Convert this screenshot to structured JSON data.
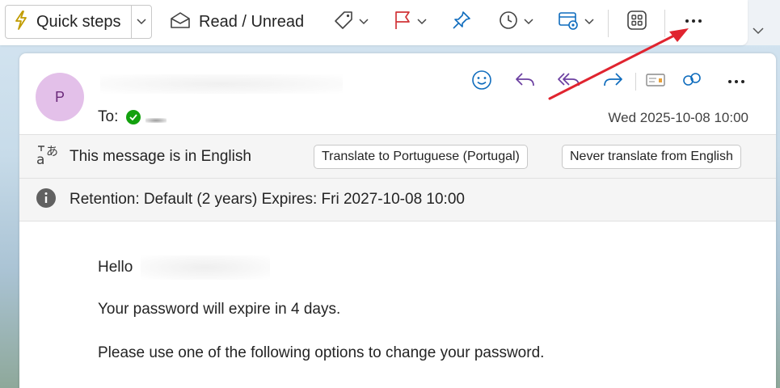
{
  "toolbar": {
    "quick_steps_label": "Quick steps",
    "read_unread_label": "Read / Unread",
    "more_label": "⋯"
  },
  "message": {
    "avatar_initial": "P",
    "to_label": "To:",
    "date": "Wed 2025-10-08 10:00",
    "translate_notice": "This message is in English",
    "translate_button": "Translate to Portuguese (Portugal)",
    "never_translate_button": "Never translate from English",
    "retention_notice": "Retention: Default (2 years) Expires: Fri 2027-10-08 10:00",
    "body": {
      "greeting": "Hello",
      "line1": "Your password will expire in 4 days.",
      "line2": "Please use one of the following options to change your password."
    }
  },
  "colors": {
    "accent_blue": "#0f6cbd",
    "reply_purple": "#6b3fa0",
    "flag_red": "#d13438",
    "annotation_red": "#e0242f",
    "avatar_bg": "#e3c0e9",
    "verified_green": "#13a10e"
  },
  "icons": [
    "quick-steps-icon",
    "envelope-open-icon",
    "tag-icon",
    "flag-icon",
    "pin-icon",
    "clock-icon",
    "rules-icon",
    "apps-icon",
    "more-icon",
    "emoji-icon",
    "reply-icon",
    "reply-all-icon",
    "forward-icon",
    "protect-icon",
    "immersive-reader-icon",
    "translate-icon",
    "info-icon"
  ]
}
